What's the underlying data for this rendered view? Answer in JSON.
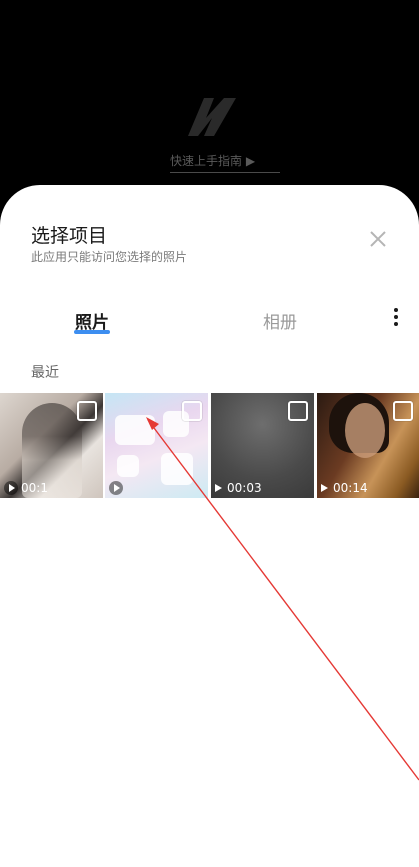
{
  "background": {
    "guide_link": "快速上手指南 ▶",
    "logo_icon": "n-logo-icon"
  },
  "sheet": {
    "title": "选择项目",
    "subtitle": "此应用只能访问您选择的照片",
    "close_icon": "close-icon",
    "tabs": [
      {
        "label": "照片",
        "selected": true
      },
      {
        "label": "相册",
        "selected": false
      }
    ],
    "more_icon": "more-vertical-icon",
    "section_label": "最近",
    "items": [
      {
        "kind": "video",
        "duration": "00:1"
      },
      {
        "kind": "video",
        "duration": ""
      },
      {
        "kind": "video",
        "duration": "00:03"
      },
      {
        "kind": "video",
        "duration": "00:14"
      }
    ]
  },
  "colors": {
    "accent": "#3d8ef0",
    "annotation_arrow": "#e53935"
  }
}
